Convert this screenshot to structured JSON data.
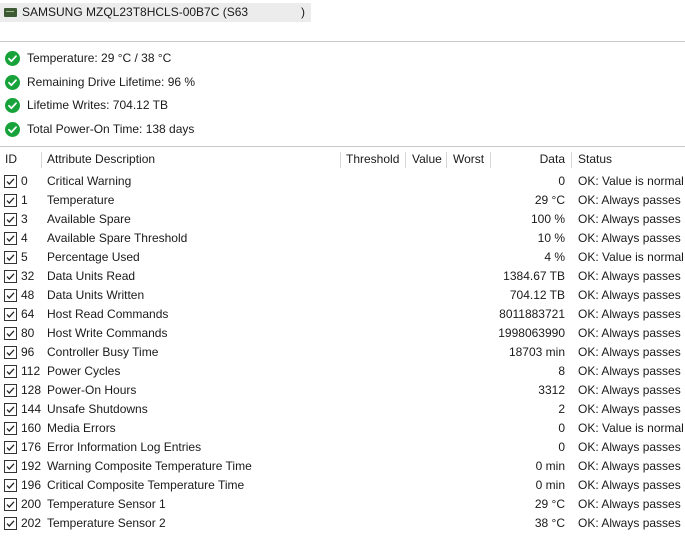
{
  "drive": {
    "icon": "drive-icon",
    "name": "SAMSUNG MZQL23T8HCLS-00B7C (S63",
    "closing_paren": ")"
  },
  "summary": [
    {
      "icon": "ok-check-icon",
      "text": "Temperature: 29 °C / 38 °C"
    },
    {
      "icon": "ok-check-icon",
      "text": "Remaining Drive Lifetime: 96 %"
    },
    {
      "icon": "ok-check-icon",
      "text": "Lifetime Writes: 704.12 TB"
    },
    {
      "icon": "ok-check-icon",
      "text": "Total Power-On Time: 138 days"
    }
  ],
  "table": {
    "columns": {
      "id": "ID",
      "description": "Attribute Description",
      "threshold": "Threshold",
      "value": "Value",
      "worst": "Worst",
      "data": "Data",
      "status": "Status"
    },
    "rows": [
      {
        "checked": true,
        "id": "0",
        "description": "Critical Warning",
        "data": "0",
        "status": "OK: Value is normal"
      },
      {
        "checked": true,
        "id": "1",
        "description": "Temperature",
        "data": "29 °C",
        "status": "OK: Always passes"
      },
      {
        "checked": true,
        "id": "3",
        "description": "Available Spare",
        "data": "100 %",
        "status": "OK: Always passes"
      },
      {
        "checked": true,
        "id": "4",
        "description": "Available Spare Threshold",
        "data": "10 %",
        "status": "OK: Always passes"
      },
      {
        "checked": true,
        "id": "5",
        "description": "Percentage Used",
        "data": "4 %",
        "status": "OK: Value is normal"
      },
      {
        "checked": true,
        "id": "32",
        "description": "Data Units Read",
        "data": "1384.67 TB",
        "status": "OK: Always passes"
      },
      {
        "checked": true,
        "id": "48",
        "description": "Data Units Written",
        "data": "704.12 TB",
        "status": "OK: Always passes"
      },
      {
        "checked": true,
        "id": "64",
        "description": "Host Read Commands",
        "data": "8011883721",
        "status": "OK: Always passes"
      },
      {
        "checked": true,
        "id": "80",
        "description": "Host Write Commands",
        "data": "1998063990",
        "status": "OK: Always passes"
      },
      {
        "checked": true,
        "id": "96",
        "description": "Controller Busy Time",
        "data": "18703 min",
        "status": "OK: Always passes"
      },
      {
        "checked": true,
        "id": "112",
        "description": "Power Cycles",
        "data": "8",
        "status": "OK: Always passes"
      },
      {
        "checked": true,
        "id": "128",
        "description": "Power-On Hours",
        "data": "3312",
        "status": "OK: Always passes"
      },
      {
        "checked": true,
        "id": "144",
        "description": "Unsafe Shutdowns",
        "data": "2",
        "status": "OK: Always passes"
      },
      {
        "checked": true,
        "id": "160",
        "description": "Media Errors",
        "data": "0",
        "status": "OK: Value is normal"
      },
      {
        "checked": true,
        "id": "176",
        "description": "Error Information Log Entries",
        "data": "0",
        "status": "OK: Always passes"
      },
      {
        "checked": true,
        "id": "192",
        "description": "Warning Composite Temperature Time",
        "data": "0 min",
        "status": "OK: Always passes"
      },
      {
        "checked": true,
        "id": "196",
        "description": "Critical Composite Temperature Time",
        "data": "0 min",
        "status": "OK: Always passes"
      },
      {
        "checked": true,
        "id": "200",
        "description": "Temperature Sensor 1",
        "data": "29 °C",
        "status": "OK: Always passes"
      },
      {
        "checked": true,
        "id": "202",
        "description": "Temperature Sensor 2",
        "data": "38 °C",
        "status": "OK: Always passes"
      }
    ]
  },
  "colors": {
    "ok_green": "#17a33a"
  }
}
